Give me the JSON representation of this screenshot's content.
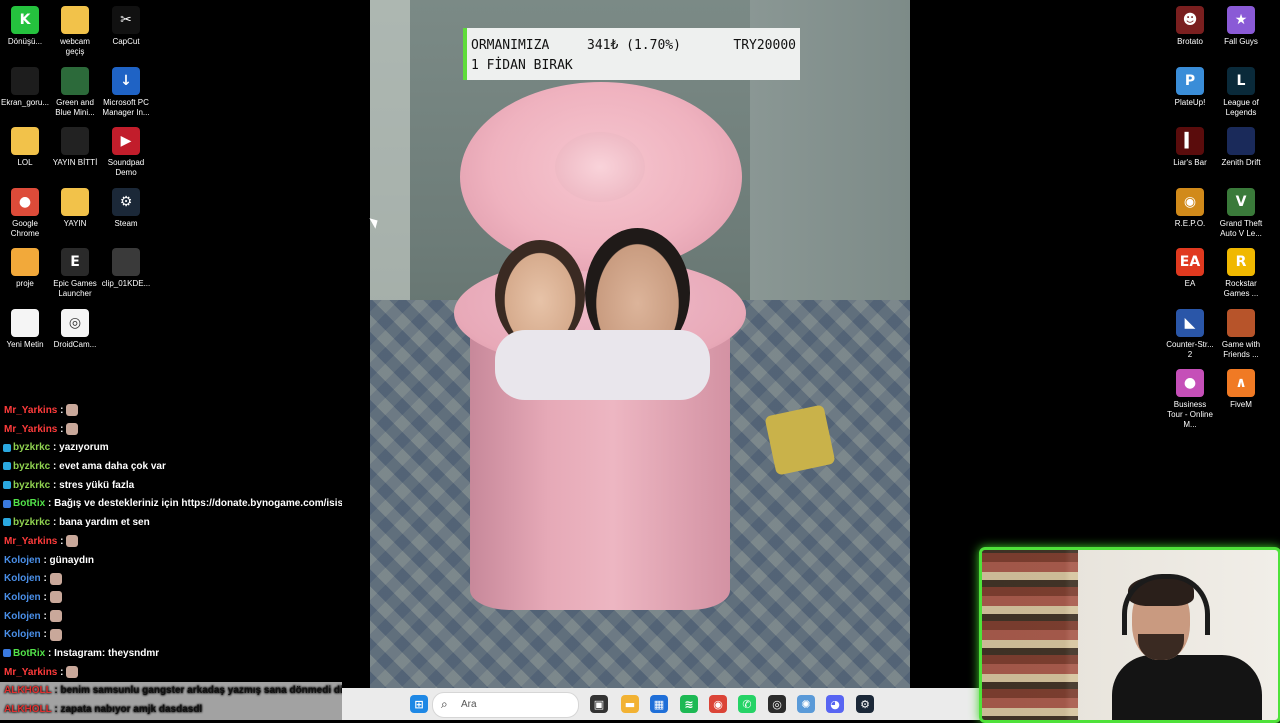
{
  "desktop_left": [
    {
      "label": "Dönüşü...",
      "icon": "k5-icon",
      "color": "#25c23e",
      "glyph": "K"
    },
    {
      "label": "webcam geçiş",
      "icon": "folder-icon",
      "color": "#f2c24a",
      "glyph": ""
    },
    {
      "label": "CapCut",
      "icon": "capcut-icon",
      "color": "#111111",
      "glyph": "✂"
    },
    {
      "label": "Ekran_goru...",
      "icon": "screenshot-icon",
      "color": "#1d1d1d",
      "glyph": ""
    },
    {
      "label": "Green and Blue Mini...",
      "icon": "video-thumb-icon",
      "color": "#2c6a3a",
      "glyph": ""
    },
    {
      "label": "Microsoft PC Manager In...",
      "icon": "installer-icon",
      "color": "#1f63c5",
      "glyph": "↓"
    },
    {
      "label": "LOL",
      "icon": "folder-icon",
      "color": "#f2c24a",
      "glyph": ""
    },
    {
      "label": "YAYIN BİTTİ",
      "icon": "video-thumb-icon",
      "color": "#222222",
      "glyph": ""
    },
    {
      "label": "Soundpad Demo",
      "icon": "soundpad-icon",
      "color": "#c21d2b",
      "glyph": "▶"
    },
    {
      "label": "Google Chrome",
      "icon": "chrome-icon",
      "color": "#dd4b39",
      "glyph": "●"
    },
    {
      "label": "YAYIN",
      "icon": "folder-icon",
      "color": "#f2c24a",
      "glyph": ""
    },
    {
      "label": "Steam",
      "icon": "steam-icon",
      "color": "#1b2838",
      "glyph": "⚙"
    },
    {
      "label": "proje",
      "icon": "folder-icon",
      "color": "#f2a93a",
      "glyph": ""
    },
    {
      "label": "Epic Games Launcher",
      "icon": "epic-icon",
      "color": "#2a2a2a",
      "glyph": "E"
    },
    {
      "label": "clip_01KDE...",
      "icon": "video-thumb-icon",
      "color": "#3a3a3a",
      "glyph": ""
    },
    {
      "label": "Yeni Metin",
      "icon": "text-file-icon",
      "color": "#f5f5f5",
      "glyph": ""
    },
    {
      "label": "DroidCam...",
      "icon": "droidcam-icon",
      "color": "#f5f5f5",
      "glyph": "◎"
    }
  ],
  "desktop_right": [
    {
      "label": "Brotato",
      "icon": "brotato-icon",
      "color": "#7a1f1f",
      "glyph": "☻"
    },
    {
      "label": "Fall Guys",
      "icon": "fall-guys-icon",
      "color": "#8a5ad6",
      "glyph": "★"
    },
    {
      "label": "PlateUp!",
      "icon": "plateup-icon",
      "color": "#3a8dd8",
      "glyph": "P"
    },
    {
      "label": "League of Legends",
      "icon": "lol-icon",
      "color": "#0a2a3a",
      "glyph": "L"
    },
    {
      "label": "Liar's Bar",
      "icon": "liars-bar-icon",
      "color": "#5a0c0c",
      "glyph": "▍"
    },
    {
      "label": "Zenith Drift",
      "icon": "zenith-drift-icon",
      "color": "#1a2a5a",
      "glyph": ""
    },
    {
      "label": "R.E.P.O.",
      "icon": "repo-icon",
      "color": "#d18a1a",
      "glyph": "◉"
    },
    {
      "label": "Grand Theft Auto V Le...",
      "icon": "gta-icon",
      "color": "#3a7a3a",
      "glyph": "V"
    },
    {
      "label": "EA",
      "icon": "ea-icon",
      "color": "#e0391f",
      "glyph": "EA"
    },
    {
      "label": "Rockstar Games ...",
      "icon": "rockstar-icon",
      "color": "#f0b800",
      "glyph": "R"
    },
    {
      "label": "Counter-Str... 2",
      "icon": "cs2-icon",
      "color": "#2a56a8",
      "glyph": "◣"
    },
    {
      "label": "Game with Friends ...",
      "icon": "game-icon",
      "color": "#b7542a",
      "glyph": ""
    },
    {
      "label": "Business Tour - Online M...",
      "icon": "business-tour-icon",
      "color": "#c54fb8",
      "glyph": "●"
    },
    {
      "label": "FiveM",
      "icon": "fivem-icon",
      "color": "#f07a24",
      "glyph": "∧"
    }
  ],
  "donation": {
    "title": "ORMANIMIZA",
    "count": "341₺ (1.70%)",
    "goal": "TRY20000",
    "subtitle": "1 FİDAN BIRAK"
  },
  "chat": [
    {
      "user": "Mr_Yarkins",
      "color": "#ff3b3b",
      "text": ":",
      "badge": "",
      "emote": true,
      "hl": false
    },
    {
      "user": "Mr_Yarkins",
      "color": "#ff3b3b",
      "text": ":",
      "badge": "",
      "emote": true,
      "hl": false
    },
    {
      "user": "byzkrkc",
      "color": "#8fd14f",
      "text": ": yazıyorum",
      "badge": "#2aa8e0",
      "emote": false,
      "hl": false
    },
    {
      "user": "byzkrkc",
      "color": "#8fd14f",
      "text": ": evet ama daha çok var",
      "badge": "#2aa8e0",
      "emote": false,
      "hl": false
    },
    {
      "user": "byzkrkc",
      "color": "#8fd14f",
      "text": ": stres yükü fazla",
      "badge": "#2aa8e0",
      "emote": false,
      "hl": false
    },
    {
      "user": "BotRix",
      "color": "#53e34a",
      "text": ": Bağış ve destekleriniz için https://donate.bynogame.com/isis",
      "badge": "#3a7ae0",
      "emote": false,
      "hl": false
    },
    {
      "user": "byzkrkc",
      "color": "#8fd14f",
      "text": ": bana yardım et sen",
      "badge": "#2aa8e0",
      "emote": false,
      "hl": false
    },
    {
      "user": "Mr_Yarkins",
      "color": "#ff3b3b",
      "text": ":",
      "badge": "",
      "emote": true,
      "hl": false
    },
    {
      "user": "Kolojen",
      "color": "#4a8fe8",
      "text": ": günaydın",
      "badge": "",
      "emote": false,
      "hl": false
    },
    {
      "user": "Kolojen",
      "color": "#4a8fe8",
      "text": ":",
      "badge": "",
      "emote": true,
      "hl": false
    },
    {
      "user": "Kolojen",
      "color": "#4a8fe8",
      "text": ":",
      "badge": "",
      "emote": true,
      "hl": false
    },
    {
      "user": "Kolojen",
      "color": "#4a8fe8",
      "text": ":",
      "badge": "",
      "emote": true,
      "hl": false
    },
    {
      "user": "Kolojen",
      "color": "#4a8fe8",
      "text": ":",
      "badge": "",
      "emote": true,
      "hl": false
    },
    {
      "user": "BotRix",
      "color": "#53e34a",
      "text": ": Instagram: theysndmr",
      "badge": "#3a7ae0",
      "emote": false,
      "hl": false
    },
    {
      "user": "Mr_Yarkins",
      "color": "#ff3b3b",
      "text": ":",
      "badge": "",
      "emote": true,
      "hl": false
    },
    {
      "user": "ALKHOLL",
      "color": "#e03030",
      "text": ": benim samsunlu gangster arkadaş yazmış sana dönmedi diy",
      "badge": "",
      "emote": false,
      "hl": true
    },
    {
      "user": "ALKHOLL",
      "color": "#e03030",
      "text": ": zapata nabıyor amjk dasdasdl",
      "badge": "",
      "emote": false,
      "hl": true
    }
  ],
  "taskbar": {
    "search_placeholder": "Ara",
    "apps": [
      {
        "name": "windows-start-icon",
        "color": "#1e88e5",
        "glyph": "⊞"
      },
      {
        "name": "task-view-icon",
        "color": "#333333",
        "glyph": "▣"
      },
      {
        "name": "file-explorer-icon",
        "color": "#f2b233",
        "glyph": "▬"
      },
      {
        "name": "store-icon",
        "color": "#1f6fd8",
        "glyph": "▦"
      },
      {
        "name": "spotify-icon",
        "color": "#1db954",
        "glyph": "≋"
      },
      {
        "name": "chrome-icon",
        "color": "#db4437",
        "glyph": "◉"
      },
      {
        "name": "whatsapp-icon",
        "color": "#25d366",
        "glyph": "✆"
      },
      {
        "name": "obs-icon",
        "color": "#2b2b2b",
        "glyph": "◎"
      },
      {
        "name": "network-icon",
        "color": "#5a9ad8",
        "glyph": "✺"
      },
      {
        "name": "discord-icon",
        "color": "#5865f2",
        "glyph": "◕"
      },
      {
        "name": "steam-icon",
        "color": "#1b2838",
        "glyph": "⚙"
      }
    ]
  }
}
